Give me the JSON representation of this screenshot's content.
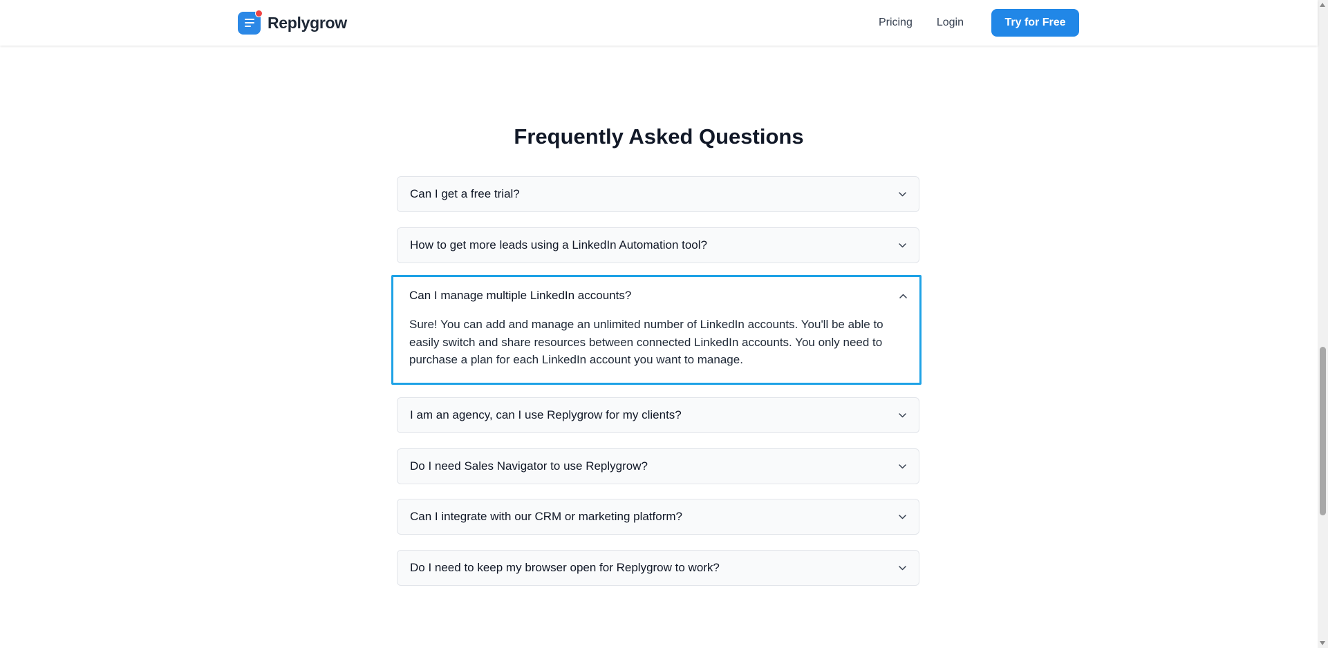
{
  "header": {
    "logo_text": "Replygrow",
    "logo_icon": "replygrow-logo-icon",
    "nav": [
      {
        "label": "Pricing"
      },
      {
        "label": "Login"
      }
    ],
    "cta_label": "Try for Free",
    "colors": {
      "accent": "#2187e7",
      "badge": "#ef4444"
    }
  },
  "faq": {
    "title": "Frequently Asked Questions",
    "items": [
      {
        "question": "Can I get a free trial?",
        "expanded": false
      },
      {
        "question": "How to get more leads using a LinkedIn Automation tool?",
        "expanded": false
      },
      {
        "question": "Can I manage multiple LinkedIn accounts?",
        "expanded": true,
        "answer": "Sure! You can add and manage an unlimited number of LinkedIn accounts. You'll be able to easily switch and share resources between connected LinkedIn accounts. You only need to purchase a plan for each LinkedIn account you want to manage."
      },
      {
        "question": "I am an agency, can I use Replygrow for my clients?",
        "expanded": false
      },
      {
        "question": "Do I need Sales Navigator to use Replygrow?",
        "expanded": false
      },
      {
        "question": "Can I integrate with our CRM or marketing platform?",
        "expanded": false
      },
      {
        "question": "Do I need to keep my browser open for Replygrow to work?",
        "expanded": false
      }
    ],
    "focus_color": "#1ea2e6"
  }
}
